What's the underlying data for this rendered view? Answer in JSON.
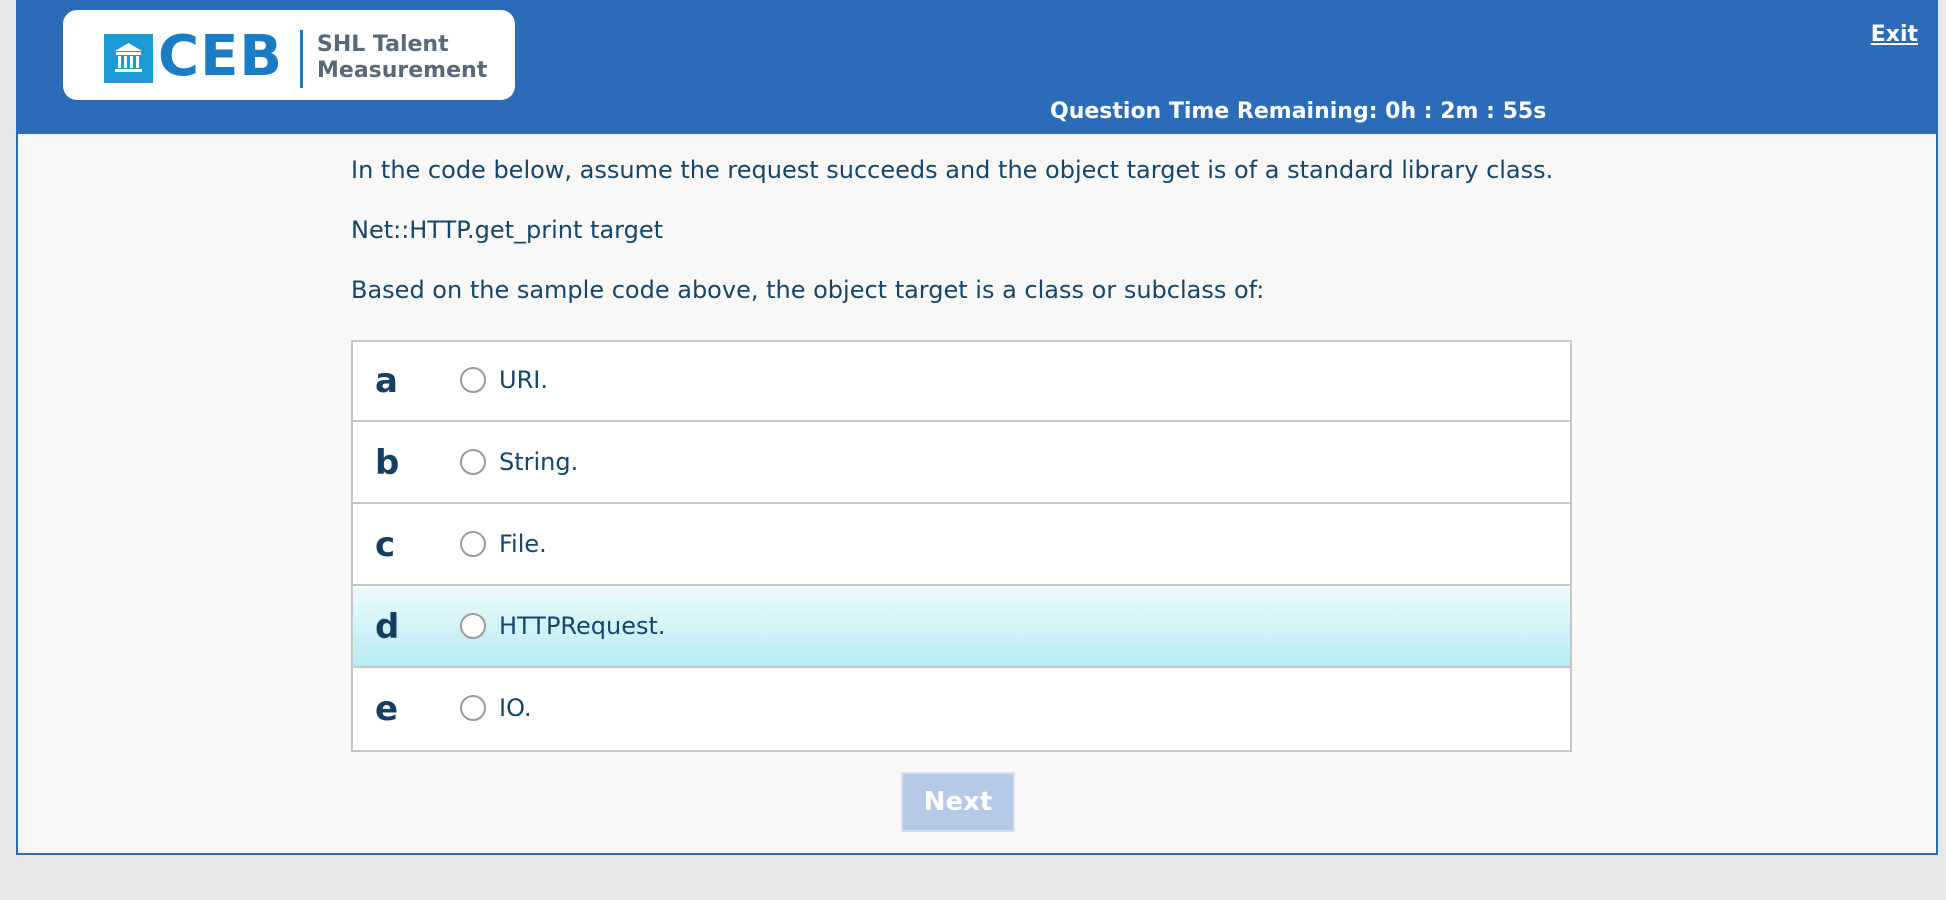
{
  "header": {
    "logo": {
      "icon": "building-icon",
      "brand": "CEB",
      "subtitle_line1": "SHL Talent",
      "subtitle_line2": "Measurement"
    },
    "exit_label": "Exit",
    "timer_text": "Question Time Remaining: 0h : 2m : 55s"
  },
  "question": {
    "line1": "In the code below, assume the request succeeds and the object target is of a standard library class.",
    "code": "Net::HTTP.get_print target",
    "prompt": "Based on the sample code above, the object target is a class or subclass of:"
  },
  "options": [
    {
      "letter": "a",
      "text": "URI.",
      "highlighted": false
    },
    {
      "letter": "b",
      "text": "String.",
      "highlighted": false
    },
    {
      "letter": "c",
      "text": "File.",
      "highlighted": false
    },
    {
      "letter": "d",
      "text": "HTTPRequest.",
      "highlighted": true
    },
    {
      "letter": "e",
      "text": "IO.",
      "highlighted": false
    }
  ],
  "next_button": {
    "label": "Next",
    "enabled": false
  },
  "colors": {
    "header_bg": "#2b6cb9",
    "text": "#14466b",
    "highlight": "#b7ebf2",
    "next_disabled": "#b5cae6"
  }
}
